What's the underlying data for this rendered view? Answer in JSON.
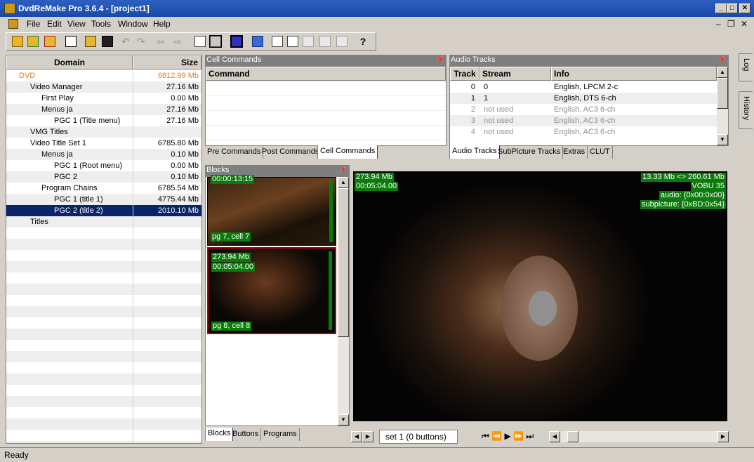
{
  "window": {
    "title": "DvdReMake Pro 3.6.4 - [project1]"
  },
  "menu": {
    "file": "File",
    "edit": "Edit",
    "view": "View",
    "tools": "Tools",
    "window": "Window",
    "help": "Help"
  },
  "tree": {
    "col_domain": "Domain",
    "col_size": "Size",
    "rows": [
      {
        "label": "DVD",
        "size": "6812.99 Mb"
      },
      {
        "label": "Video Manager",
        "size": "27.16 Mb"
      },
      {
        "label": "First Play",
        "size": "0.00 Mb"
      },
      {
        "label": "Menus ja",
        "size": "27.16 Mb"
      },
      {
        "label": "PGC 1 (Title menu)",
        "size": "27.16 Mb"
      },
      {
        "label": "VMG Titles",
        "size": ""
      },
      {
        "label": "Video Title Set 1",
        "size": "6785.80 Mb"
      },
      {
        "label": "Menus ja",
        "size": "0.10 Mb"
      },
      {
        "label": "PGC 1 (Root menu)",
        "size": "0.00 Mb"
      },
      {
        "label": "PGC 2",
        "size": "0.10 Mb"
      },
      {
        "label": "Program Chains",
        "size": "6785.54 Mb"
      },
      {
        "label": "PGC 1  (title 1)",
        "size": "4775.44 Mb"
      },
      {
        "label": "PGC 2  (title 2)",
        "size": "2010.10 Mb"
      },
      {
        "label": "Titles",
        "size": ""
      }
    ]
  },
  "cell_commands": {
    "title": "Cell Commands",
    "col_command": "Command",
    "tabs": [
      "Pre Commands",
      "Post Commands",
      "Cell Commands"
    ]
  },
  "audio": {
    "title": "Audio Tracks",
    "col_track": "Track",
    "col_stream": "Stream",
    "col_info": "Info",
    "rows": [
      {
        "track": "0",
        "stream": "0",
        "info": "English,  LPCM 2-ch",
        "used": true
      },
      {
        "track": "1",
        "stream": "1",
        "info": "English,  DTS 6-ch",
        "used": true
      },
      {
        "track": "2",
        "stream": "not used",
        "info": "English,  AC3 6-ch",
        "used": false
      },
      {
        "track": "3",
        "stream": "not used",
        "info": "English,  AC3 6-ch",
        "used": false
      },
      {
        "track": "4",
        "stream": "not used",
        "info": "English,  AC3 6-ch",
        "used": false
      }
    ],
    "tabs": [
      "Audio Tracks",
      "SubPicture Tracks",
      "Extras",
      "CLUT"
    ]
  },
  "blocks": {
    "title": "Blocks",
    "thumbs": [
      {
        "top": "00:00:13:15",
        "label": "pg 7, cell 7"
      },
      {
        "size": "273.94 Mb",
        "time": "00:05:04.00",
        "label": "pg 8, cell 8"
      }
    ],
    "tabs": [
      "Blocks",
      "Buttons",
      "Programs"
    ]
  },
  "preview": {
    "size": "273.94 Mb",
    "time": "00:05:04.00",
    "range": "13.33 Mb <> 260.61 Mb",
    "vobu": "VOBU 35",
    "audio": "audio: {0x00:0x00}",
    "subpicture": "subpicture: {0xBD:0x54}",
    "tab": "set 1 (0 buttons)"
  },
  "side": {
    "log": "Log",
    "history": "History"
  },
  "status": {
    "text": "Ready"
  }
}
